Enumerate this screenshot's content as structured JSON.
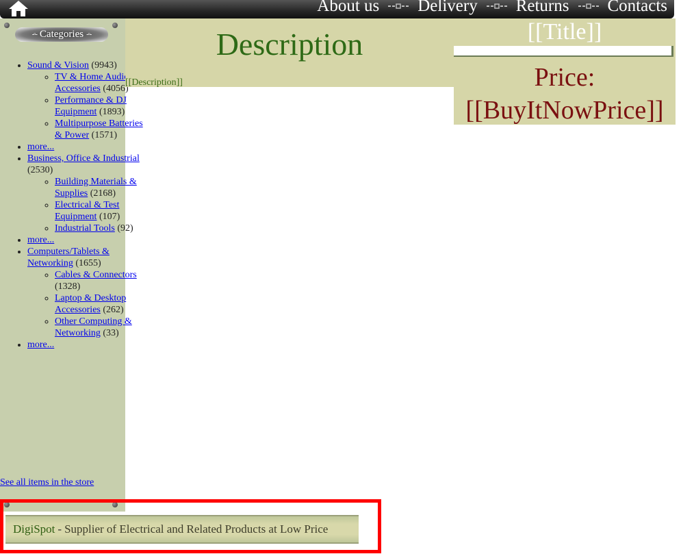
{
  "nav": {
    "items": [
      {
        "label": "About us"
      },
      {
        "label": "Delivery"
      },
      {
        "label": "Returns"
      },
      {
        "label": "Contacts"
      }
    ]
  },
  "sidebar": {
    "header": "Categories",
    "categories": [
      {
        "label": "Sound & Vision",
        "count": "(9943)",
        "children": [
          {
            "label": "TV & Home Audio Accessories",
            "count": "(4056)"
          },
          {
            "label": "Performance & DJ Equipment",
            "count": "(1893)"
          },
          {
            "label": "Multipurpose Batteries & Power",
            "count": "(1571)"
          }
        ]
      },
      {
        "label": "more...",
        "count": ""
      },
      {
        "label": "Business, Office & Industrial",
        "count": "(2530)",
        "children": [
          {
            "label": "Building Materials & Supplies",
            "count": "(2168)"
          },
          {
            "label": "Electrical & Test Equipment",
            "count": "(107)"
          },
          {
            "label": "Industrial Tools",
            "count": "(92)"
          }
        ]
      },
      {
        "label": "more...",
        "count": ""
      },
      {
        "label": "Computers/Tablets & Networking",
        "count": "(1655)",
        "children": [
          {
            "label": "Cables & Connectors",
            "count": "(1328)"
          },
          {
            "label": "Laptop & Desktop Accessories",
            "count": "(262)"
          },
          {
            "label": "Other Computing & Networking",
            "count": "(33)"
          }
        ]
      },
      {
        "label": "more...",
        "count": ""
      }
    ],
    "see_all": "See all items in the store"
  },
  "description": {
    "heading": "Description",
    "text": "[[Description]]"
  },
  "item": {
    "title": "[[Title]]",
    "price_label": "Price:",
    "price_value": "[[BuyItNowPrice]]"
  },
  "footer": {
    "brand": "DigiSpot",
    "separator": "-",
    "tagline": "Supplier of Electrical and Related Products at Low Price"
  },
  "colors": {
    "panel": "#d6d6a8",
    "sidebar": "#c7cfad",
    "price": "#7a1010",
    "description": "#2e6a16",
    "highlight": "#ff0000"
  }
}
